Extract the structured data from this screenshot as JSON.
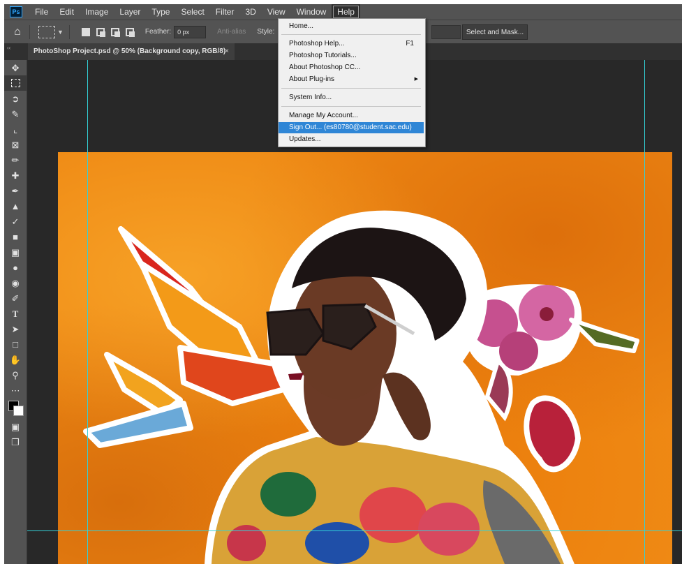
{
  "menubar": {
    "logo": "Ps",
    "items": [
      "File",
      "Edit",
      "Image",
      "Layer",
      "Type",
      "Select",
      "Filter",
      "3D",
      "View",
      "Window",
      "Help"
    ],
    "active": "Help"
  },
  "options": {
    "feather_label": "Feather:",
    "feather_value": "0 px",
    "antialias_label": "Anti-alias",
    "style_label": "Style:",
    "select_mask_label": "Select and Mask..."
  },
  "document_tab": {
    "title": "PhotoShop Project.psd @ 50% (Background copy, RGB/8)",
    "close": "×"
  },
  "toolbar": {
    "tools": [
      "move-tool",
      "marquee-tool",
      "lasso-tool",
      "quick-selection-tool",
      "crop-tool",
      "frame-tool",
      "eyedropper-tool",
      "healing-brush-tool",
      "brush-tool",
      "clone-stamp-tool",
      "history-brush-tool",
      "eraser-tool",
      "gradient-tool",
      "blur-tool",
      "dodge-tool",
      "pen-tool",
      "type-tool",
      "path-selection-tool",
      "rectangle-tool",
      "hand-tool",
      "zoom-tool",
      "more-tools"
    ],
    "selected": "marquee-tool"
  },
  "help_menu": {
    "items": [
      {
        "label": "Home...",
        "shortcut": ""
      },
      {
        "label": "Photoshop Help...",
        "shortcut": "F1"
      },
      {
        "label": "Photoshop Tutorials...",
        "shortcut": ""
      },
      {
        "label": "About Photoshop CC...",
        "shortcut": ""
      },
      {
        "label": "About Plug-ins",
        "shortcut": "",
        "submenu": true
      },
      {
        "label": "System Info...",
        "shortcut": ""
      },
      {
        "label": "Manage My Account...",
        "shortcut": ""
      },
      {
        "label": "Sign Out... (es80780@student.sac.edu)",
        "shortcut": "",
        "highlighted": true
      },
      {
        "label": "Updates...",
        "shortcut": ""
      }
    ]
  },
  "colors": {
    "guide": "#33d1d8",
    "highlight": "#2f86d6",
    "canvas_background": "#ef8914"
  }
}
